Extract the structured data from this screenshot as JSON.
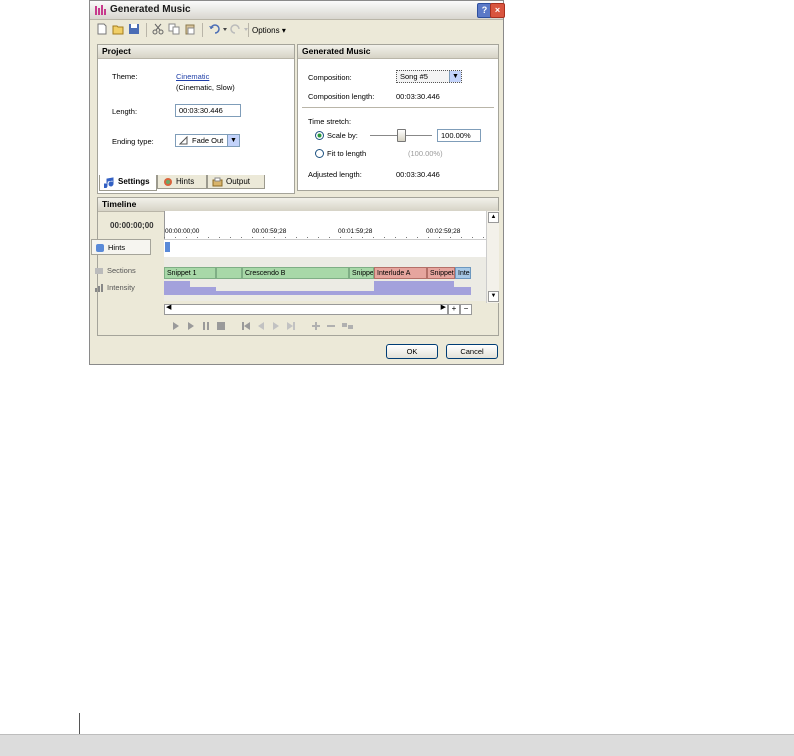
{
  "window": {
    "title": "Generated Music",
    "help_label": "?",
    "close_label": "×"
  },
  "toolbar": {
    "options_label": "Options",
    "options_arrow": "▾"
  },
  "project": {
    "header": "Project",
    "theme_label": "Theme:",
    "theme_value": "Cinematic",
    "theme_detail": "(Cinematic, Slow)",
    "length_label": "Length:",
    "length_value": "00:03:30.446",
    "ending_label": "Ending type:",
    "ending_value": "Fade Out"
  },
  "generated": {
    "header": "Generated Music",
    "composition_label": "Composition:",
    "composition_value": "Song #5",
    "comp_length_label": "Composition length:",
    "comp_length_value": "00:03:30.446",
    "time_stretch_label": "Time stretch:",
    "scale_by_label": "Scale by:",
    "scale_value": "100.00%",
    "fit_label": "Fit to length",
    "fit_value": "(100.00%)",
    "adjusted_label": "Adjusted length:",
    "adjusted_value": "00:03:30.446",
    "scale_level": 0.5
  },
  "tabs": [
    {
      "label": "Settings"
    },
    {
      "label": "Hints"
    },
    {
      "label": "Output"
    }
  ],
  "timeline": {
    "header": "Timeline",
    "time_display": "00:00:00;00",
    "ruler": [
      "00:00:00;00",
      "00:00:59;28",
      "00:01:59;28",
      "00:02:59;28"
    ],
    "tracks": [
      {
        "label": "Hints"
      },
      {
        "label": "Sections"
      },
      {
        "label": "Intensity"
      }
    ],
    "clips": [
      "Snippet 1",
      "Crescendo B",
      "Snippet",
      "Interlude A",
      "Snippet",
      "Inte"
    ]
  },
  "buttons": {
    "ok": "OK",
    "cancel": "Cancel"
  },
  "colors": {
    "panel_head": "#d6d3c6",
    "clip_green": "#a8d8a8",
    "clip_red": "#e6a59e",
    "clip_blue": "#a7c9e6",
    "intensity": "#9e9cd8"
  }
}
